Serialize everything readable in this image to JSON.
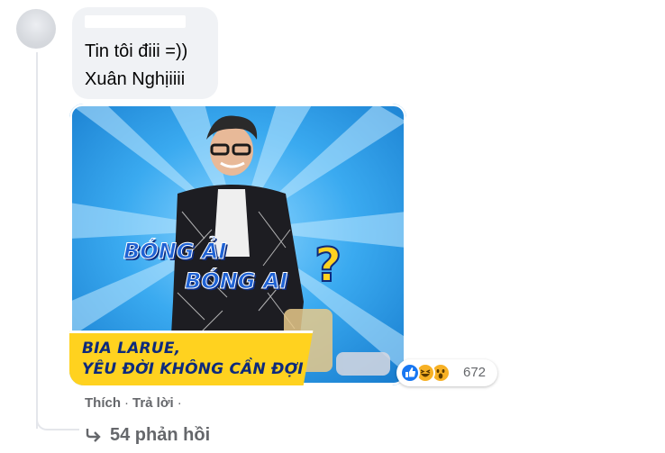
{
  "comment": {
    "lines": [
      "Tin tôi điii =))",
      "Xuân Nghịiiii"
    ]
  },
  "attachment": {
    "title_line1": "BÓNG ẢI",
    "title_line2": "BÓNG AI",
    "question_mark": "?",
    "banner_line1": "BIA LARUE,",
    "banner_line2": "YÊU ĐỜI KHÔNG CẦN ĐỢI"
  },
  "reactions": {
    "icons": [
      "like-icon",
      "haha-icon",
      "wow-icon"
    ],
    "count": "672",
    "colors": {
      "like": "#1877f2",
      "haha": "#f7b125",
      "wow": "#f7b125"
    }
  },
  "actions": {
    "like": "Thích",
    "separator": "·",
    "reply": "Trả lời",
    "trailing_separator": "·"
  },
  "replies": {
    "label": "54 phản hồi"
  },
  "colors": {
    "bubble_bg": "#f0f2f5",
    "secondary_text": "#65676b",
    "banner_yellow": "#ffd21f",
    "photo_blue": "#2ea0e6"
  }
}
